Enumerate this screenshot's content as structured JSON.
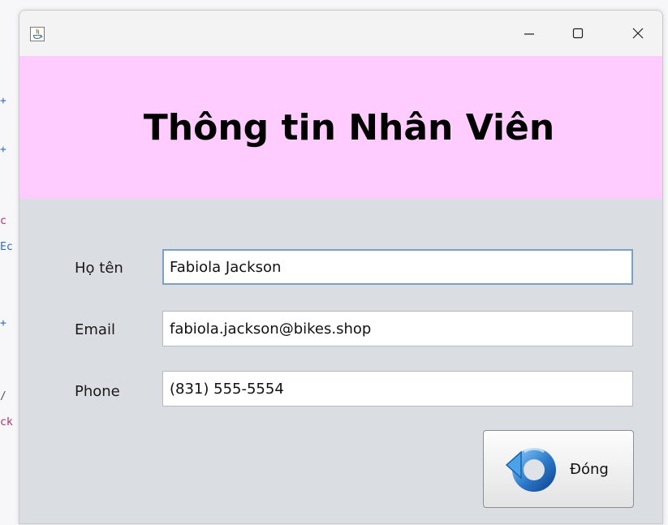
{
  "background_editor": {
    "fragments": [
      "+",
      "+",
      "c",
      "Ec",
      "+",
      "/",
      "ck"
    ]
  },
  "window": {
    "title": "",
    "controls": {
      "minimize": "—",
      "maximize": "☐",
      "close": "✕"
    }
  },
  "header": {
    "title": "Thông tin Nhân Viên",
    "background": "#ffccff"
  },
  "form": {
    "fields": [
      {
        "label": "Họ tên",
        "value": "Fabiola Jackson"
      },
      {
        "label": "Email",
        "value": "fabiola.jackson@bikes.shop"
      },
      {
        "label": "Phone",
        "value": "(831) 555-5554"
      }
    ]
  },
  "actions": {
    "close_label": "Đóng",
    "close_icon": "undo-arrow-icon"
  },
  "colors": {
    "body_bg": "#dadde2",
    "accent_blue": "#2b78c8"
  }
}
